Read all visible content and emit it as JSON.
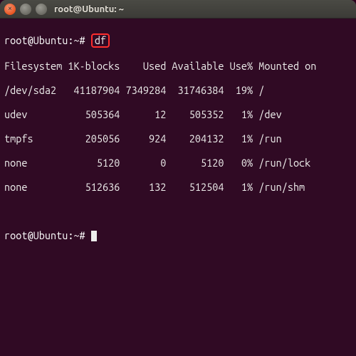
{
  "window": {
    "title": "root@Ubuntu: ~"
  },
  "prompt": "root@Ubuntu:~#",
  "command": "df",
  "headers": {
    "filesystem": "Filesystem",
    "blocks": "1K-blocks",
    "used": "Used",
    "available": "Available",
    "use_pct": "Use%",
    "mounted_on": "Mounted on"
  },
  "rows": [
    {
      "filesystem": "/dev/sda2",
      "blocks": "41187904",
      "used": "7349284",
      "available": "31746384",
      "use_pct": "19%",
      "mounted_on": "/"
    },
    {
      "filesystem": "udev",
      "blocks": "505364",
      "used": "12",
      "available": "505352",
      "use_pct": "1%",
      "mounted_on": "/dev"
    },
    {
      "filesystem": "tmpfs",
      "blocks": "205056",
      "used": "924",
      "available": "204132",
      "use_pct": "1%",
      "mounted_on": "/run"
    },
    {
      "filesystem": "none",
      "blocks": "5120",
      "used": "0",
      "available": "5120",
      "use_pct": "0%",
      "mounted_on": "/run/lock"
    },
    {
      "filesystem": "none",
      "blocks": "512636",
      "used": "132",
      "available": "512504",
      "use_pct": "1%",
      "mounted_on": "/run/shm"
    }
  ]
}
